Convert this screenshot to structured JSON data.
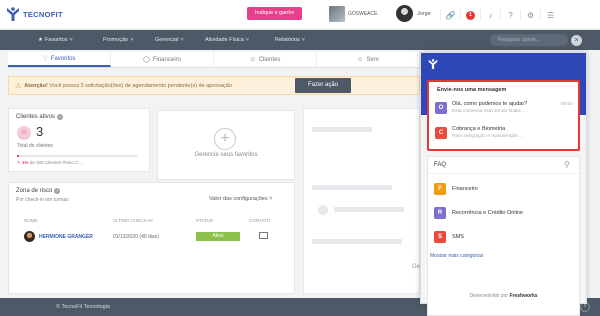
{
  "app": {
    "logo_text": "TECNOFIT"
  },
  "header": {
    "indique_label": "Indique e ganhe",
    "gym_name": "GOSWEACE",
    "user_name": "Jorge",
    "alert_count": "1"
  },
  "nav": {
    "items": [
      {
        "label": "Favoritos"
      },
      {
        "label": "Promoção"
      },
      {
        "label": "Gerencial"
      },
      {
        "label": "Atividade Física"
      },
      {
        "label": "Relatórios"
      }
    ],
    "search_placeholder": "Pesquisar cliente..."
  },
  "tabs": [
    {
      "label": "Favoritos"
    },
    {
      "label": "Financeiro"
    },
    {
      "label": "Clientes"
    },
    {
      "label": "Serv"
    }
  ],
  "alert": {
    "prefix": "Atenção!",
    "text": "Você possui 3 solicitação(ões) de agendamento pendente(s) de aprovação",
    "button": "Fazer ação"
  },
  "clients": {
    "title": "Clientes ativos",
    "count": "3",
    "total_label": "Total de clientes",
    "progress": 0.01,
    "progress_highlight": "1%",
    "progress_text": "de 300 Clientes Plano C..."
  },
  "favorites": {
    "manage_label": "Gerencie seus favoritos"
  },
  "risk": {
    "title": "Zona de risco",
    "subtitle": "Por check-in em turmas",
    "select_label": "Valor das configurações",
    "columns": [
      "NOME",
      "ÚLTIMO CHECK-IN",
      "STATUS",
      "CONTATO"
    ],
    "rows": [
      {
        "name": "HERMIONE GRANGER",
        "last_checkin": "01/12/2020 (40 dias)",
        "status": "Ativo"
      }
    ]
  },
  "skeleton": {
    "label": "Ge"
  },
  "footer": {
    "text": "© TecnoFit Tecnologia"
  },
  "widget": {
    "messages_title": "Envie-nos uma mensagem",
    "messages": [
      {
        "avatar": "O",
        "title": "Olá, como podemos te ajudar?",
        "subtitle": "Esta conversa está sendo finaliz...",
        "time": "09:53",
        "color": "#7c6fd0"
      },
      {
        "avatar": "C",
        "title": "Cobrança e Biometria",
        "subtitle": "Para integração e manutenção ...",
        "time": "",
        "color": "#e74c3c"
      }
    ],
    "faq_title": "FAQ",
    "faq_items": [
      {
        "avatar": "F",
        "label": "Financeiro",
        "color": "#f39c12"
      },
      {
        "avatar": "R",
        "label": "Recorrência e Crédito Online",
        "color": "#7c6fd0"
      },
      {
        "avatar": "S",
        "label": "SMS",
        "color": "#e74c3c"
      }
    ],
    "more_label": "Mostrar mais categorias",
    "powered_label": "Desenvolvido por",
    "powered_brand": "Freshworks"
  },
  "colors": {
    "brand": "#3a5fb3",
    "nav": "#4d5966",
    "accent": "#e83e8c",
    "widget_head": "#2e48b8"
  }
}
